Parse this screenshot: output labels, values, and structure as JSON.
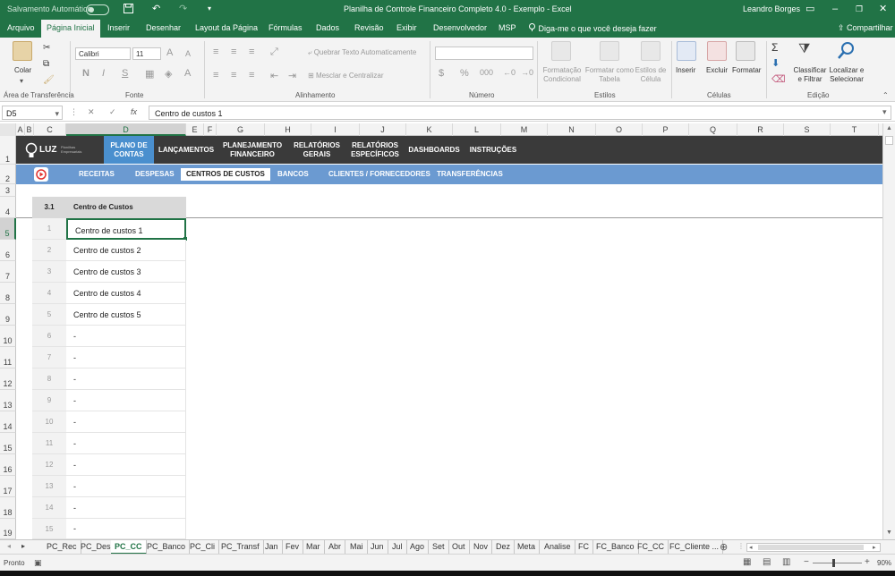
{
  "titlebar": {
    "autosave_label": "Salvamento Automático",
    "doc_title": "Planilha de Controle Financeiro Completo 4.0 - Exemplo",
    "app_name": "Excel",
    "user": "Leandro Borges"
  },
  "ribbon_tabs": [
    "Arquivo",
    "Página Inicial",
    "Inserir",
    "Desenhar",
    "Layout da Página",
    "Fórmulas",
    "Dados",
    "Revisão",
    "Exibir",
    "Desenvolvedor",
    "MSP"
  ],
  "tell_me": "Diga-me o que você deseja fazer",
  "share_label": "Compartilhar",
  "ribbon": {
    "paste": "Colar",
    "clipboard_group": "Área de Transferência",
    "font_name": "Calibri",
    "font_size": "11",
    "bold": "N",
    "italic": "I",
    "underline": "S",
    "font_group": "Fonte",
    "wrap_text": "Quebrar Texto Automaticamente",
    "merge_center": "Mesclar e Centralizar",
    "alignment_group": "Alinhamento",
    "number_group": "Número",
    "cond_format": [
      "Formatação",
      "Condicional"
    ],
    "format_table": [
      "Formatar como",
      "Tabela"
    ],
    "cell_styles": [
      "Estilos de",
      "Célula"
    ],
    "styles_group": "Estilos",
    "insert": "Inserir",
    "delete": "Excluir",
    "format": "Formatar",
    "cells_group": "Células",
    "sort_filter": [
      "Classificar",
      "e Filtrar"
    ],
    "find_select": [
      "Localizar e",
      "Selecionar"
    ],
    "editing_group": "Edição"
  },
  "formula_bar": {
    "name_box": "D5",
    "fx": "fx",
    "value": "Centro de custos 1"
  },
  "columns": [
    "A",
    "B",
    "C",
    "D",
    "E",
    "F",
    "G",
    "H",
    "I",
    "J",
    "K",
    "L",
    "M",
    "N",
    "O",
    "P",
    "Q",
    "R",
    "S",
    "T"
  ],
  "rows": [
    "1",
    "2",
    "3",
    "4",
    "5",
    "6",
    "7",
    "8",
    "9",
    "10",
    "11",
    "12",
    "13",
    "14",
    "15",
    "16",
    "17",
    "18",
    "19"
  ],
  "brand": {
    "logo": "LUZ",
    "tagline": "Planilhas Empresariais"
  },
  "nav": [
    [
      "PLANO DE",
      "CONTAS"
    ],
    [
      "LANÇAMENTOS"
    ],
    [
      "PLANEJAMENTO",
      "FINANCEIRO"
    ],
    [
      "RELATÓRIOS",
      "GERAIS"
    ],
    [
      "RELATÓRIOS",
      "ESPECÍFICOS"
    ],
    [
      "DASHBOARDS"
    ],
    [
      "INSTRUÇÕES"
    ]
  ],
  "subnav": [
    "RECEITAS",
    "DESPESAS",
    "CENTROS DE CUSTOS",
    "BANCOS",
    "CLIENTES / FORNECEDORES",
    "TRANSFERÊNCIAS"
  ],
  "table": {
    "index_header": "3.1",
    "header": "Centro de Custos",
    "rows": [
      [
        "1",
        "Centro de custos 1"
      ],
      [
        "2",
        "Centro de custos 2"
      ],
      [
        "3",
        "Centro de custos 3"
      ],
      [
        "4",
        "Centro de custos 4"
      ],
      [
        "5",
        "Centro de custos 5"
      ],
      [
        "6",
        "-"
      ],
      [
        "7",
        "-"
      ],
      [
        "8",
        "-"
      ],
      [
        "9",
        "-"
      ],
      [
        "10",
        "-"
      ],
      [
        "11",
        "-"
      ],
      [
        "12",
        "-"
      ],
      [
        "13",
        "-"
      ],
      [
        "14",
        "-"
      ],
      [
        "15",
        "-"
      ]
    ]
  },
  "sheet_tabs": [
    "PC_Rec",
    "PC_Des",
    "PC_CC",
    "PC_Banco",
    "PC_Cli",
    "PC_Transf",
    "Jan",
    "Fev",
    "Mar",
    "Abr",
    "Mai",
    "Jun",
    "Jul",
    "Ago",
    "Set",
    "Out",
    "Nov",
    "Dez",
    "Meta",
    "Analise",
    "FC",
    "FC_Banco",
    "FC_CC",
    "FC_Cliente ..."
  ],
  "active_sheet": "PC_CC",
  "status": {
    "ready": "Pronto",
    "zoom": "90%"
  }
}
